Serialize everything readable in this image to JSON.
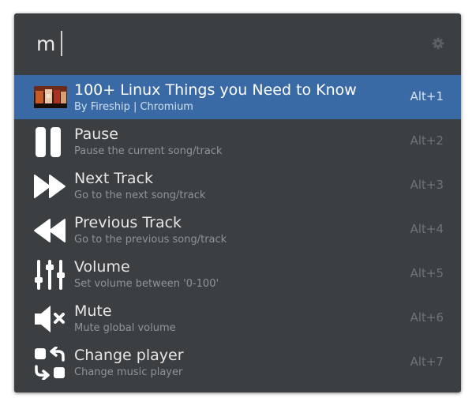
{
  "search": {
    "query": "m"
  },
  "colors": {
    "window_bg": "#3c3f41",
    "selected_row": "#3a6aa5",
    "title_text": "#e6e6e6",
    "subtitle_text": "#8f9496",
    "shortcut_text": "#6f7476"
  },
  "results": [
    {
      "title": "100+ Linux Things you Need to Know",
      "subtitle": "By Fireship | Chromium",
      "shortcut": "Alt+1",
      "icon": "video-thumbnail",
      "selected": true
    },
    {
      "title": "Pause",
      "subtitle": "Pause the current song/track",
      "shortcut": "Alt+2",
      "icon": "pause-icon"
    },
    {
      "title": "Next Track",
      "subtitle": "Go to the next song/track",
      "shortcut": "Alt+3",
      "icon": "next-track-icon"
    },
    {
      "title": "Previous Track",
      "subtitle": "Go to the previous song/track",
      "shortcut": "Alt+4",
      "icon": "previous-track-icon"
    },
    {
      "title": "Volume",
      "subtitle": "Set volume between '0-100'",
      "shortcut": "Alt+5",
      "icon": "volume-sliders-icon"
    },
    {
      "title": "Mute",
      "subtitle": "Mute global volume",
      "shortcut": "Alt+6",
      "icon": "mute-icon"
    },
    {
      "title": "Change player",
      "subtitle": "Change music player",
      "shortcut": "Alt+7",
      "icon": "change-player-icon"
    }
  ]
}
